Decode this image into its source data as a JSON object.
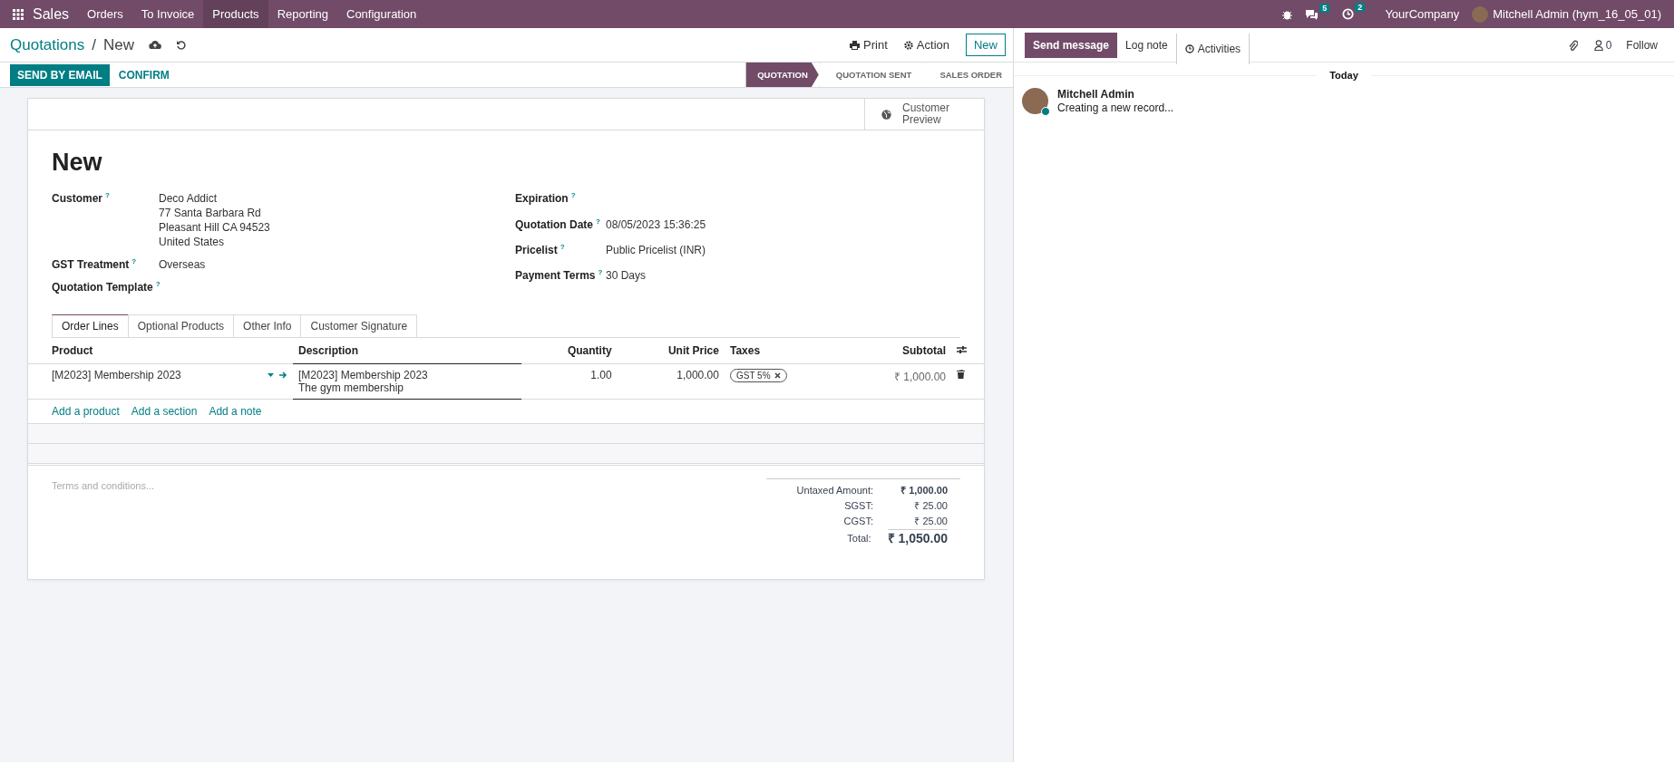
{
  "navbar": {
    "app": "Sales",
    "menu": [
      {
        "label": "Orders",
        "selected": false
      },
      {
        "label": "To Invoice",
        "selected": false
      },
      {
        "label": "Products",
        "selected": true
      },
      {
        "label": "Reporting",
        "selected": false
      },
      {
        "label": "Configuration",
        "selected": false
      }
    ],
    "messages_badge": "5",
    "activities_badge": "2",
    "company": "YourCompany",
    "user": "Mitchell Admin (hym_16_05_01)"
  },
  "breadcrumb": {
    "parent": "Quotations",
    "separator": "/",
    "current": "New"
  },
  "actions": {
    "print": "Print",
    "action": "Action",
    "new": "New"
  },
  "buttons": [
    {
      "label": "SEND BY EMAIL",
      "kind": "primary"
    },
    {
      "label": "CONFIRM",
      "kind": "link"
    }
  ],
  "statusbar": [
    {
      "label": "QUOTATION",
      "selected": true
    },
    {
      "label": "QUOTATION SENT",
      "selected": false
    },
    {
      "label": "SALES ORDER",
      "selected": false
    }
  ],
  "customer_preview": "Customer Preview",
  "title": "New",
  "left_fields": [
    {
      "label": "Customer",
      "help": "?",
      "value": [
        "Deco Addict",
        "77 Santa Barbara Rd",
        "Pleasant Hill CA 94523",
        "United States"
      ]
    },
    {
      "label": "GST Treatment",
      "help": "?",
      "value": [
        "Overseas"
      ]
    },
    {
      "label": "Quotation Template",
      "help": "?"
    }
  ],
  "right_fields": [
    {
      "label": "Expiration",
      "help": "?"
    },
    {
      "label": "Quotation Date",
      "help": "?",
      "value": [
        "08/05/2023 15:36:25"
      ]
    },
    {
      "label": "Pricelist",
      "help": "?",
      "value": [
        "Public Pricelist (INR)"
      ]
    },
    {
      "label": "Payment Terms",
      "help": "?",
      "value": [
        "30 Days"
      ]
    }
  ],
  "tabs": [
    {
      "label": "Order Lines",
      "selected": true
    },
    {
      "label": "Optional Products",
      "selected": false
    },
    {
      "label": "Other Info",
      "selected": false
    },
    {
      "label": "Customer Signature",
      "selected": false
    }
  ],
  "table": {
    "columns": [
      "Product",
      "Description",
      "Quantity",
      "Unit Price",
      "Taxes",
      "Subtotal"
    ],
    "rows": [
      {
        "product": "[M2023] Membership 2023",
        "description": [
          "[M2023] Membership 2023",
          "The gym membership"
        ],
        "quantity": "1.00",
        "unit_price": "1,000.00",
        "taxes": [
          "GST 5%"
        ],
        "subtotal": "₹ 1,000.00"
      }
    ],
    "add_links": [
      "Add a product",
      "Add a section",
      "Add a note"
    ]
  },
  "terms": {
    "placeholder": "Terms and conditions..."
  },
  "totals": [
    {
      "label": "Untaxed Amount:",
      "value": "₹ 1,000.00",
      "kind": "bold"
    },
    {
      "label": "SGST:",
      "value": "₹ 25.00",
      "kind": "plain"
    },
    {
      "label": "CGST:",
      "value": "₹ 25.00",
      "kind": "plain"
    },
    {
      "label": "Total:",
      "value": "₹ 1,050.00",
      "kind": "total"
    }
  ],
  "chatter": {
    "tabs": [
      {
        "label": "Send message",
        "selected": true
      },
      {
        "label": "Log note",
        "selected": false
      },
      {
        "label": "Activities",
        "selected": false
      }
    ],
    "followers": "0",
    "follow": "Follow",
    "day": "Today",
    "messages": [
      {
        "author": "Mitchell Admin",
        "body": "Creating a new record..."
      }
    ]
  }
}
